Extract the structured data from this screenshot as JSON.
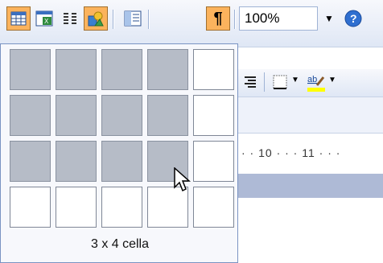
{
  "toolbar": {
    "zoom_value": "100%",
    "pilcrow": "¶",
    "help_glyph": "?",
    "icons": [
      "insert-table-icon",
      "insert-excel-icon",
      "columns-icon",
      "drawing-icon",
      "document-map-icon",
      "show-formatting-icon"
    ]
  },
  "ruler": {
    "text": "· · 10 · · · 11 · · ·"
  },
  "table_picker": {
    "rows": 4,
    "cols": 5,
    "selected_rows": 3,
    "selected_cols": 4,
    "label": "3 x 4 cella"
  },
  "colors": {
    "toolbar_top": "#f7f8fc",
    "toolbar_bottom": "#dfe7f5",
    "active_button": "#fbb35d",
    "selected_cell": "#b6bcc7",
    "ruler_band": "#aebad6"
  }
}
